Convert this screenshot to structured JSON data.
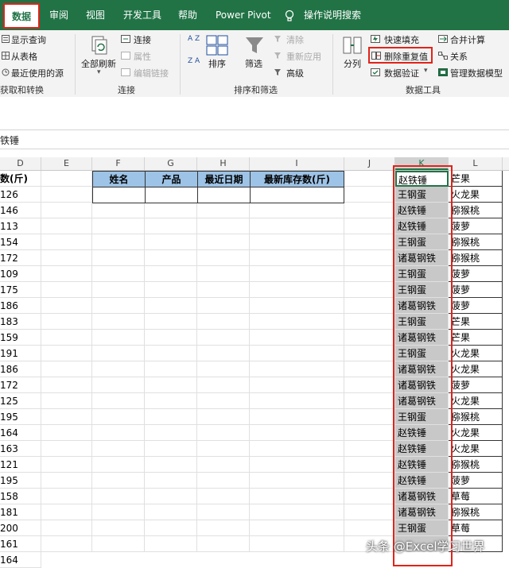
{
  "tabs": [
    "数据",
    "审阅",
    "视图",
    "开发工具",
    "帮助",
    "Power Pivot",
    "操作说明搜索"
  ],
  "ribbon": {
    "get_transform": {
      "items": [
        "显示查询",
        "从表格",
        "最近使用的源"
      ],
      "label": "获取和转换"
    },
    "connections": {
      "refresh_all": "全部刷新",
      "items": [
        "连接",
        "属性",
        "编辑链接"
      ],
      "label": "连接"
    },
    "sort_filter": {
      "sort": "排序",
      "filter": "筛选",
      "items": [
        "清除",
        "重新应用",
        "高级"
      ],
      "label": "排序和筛选"
    },
    "data_tools": {
      "split": "分列",
      "items": [
        "快速填充",
        "删除重复值",
        "数据验证",
        "合并计算",
        "关系",
        "管理数据模型"
      ],
      "label": "数据工具"
    },
    "sort_az": "A Z",
    "sort_za": "Z A"
  },
  "formula_bar": {
    "value": "铁锤"
  },
  "columns": [
    "D",
    "E",
    "F",
    "G",
    "H",
    "I",
    "J",
    "K",
    "L"
  ],
  "headers": {
    "d": "数(斤)",
    "f": "姓名",
    "g": "产品",
    "h": "最近日期",
    "i": "最新库存数(斤)"
  },
  "d_values": [
    "126",
    "146",
    "113",
    "154",
    "172",
    "109",
    "175",
    "186",
    "183",
    "159",
    "191",
    "186",
    "172",
    "125",
    "195",
    "164",
    "163",
    "121",
    "195",
    "158",
    "181",
    "200",
    "161",
    "164"
  ],
  "k_values": [
    "赵铁锤",
    "王钢蛋",
    "赵铁锤",
    "赵铁锤",
    "王钢蛋",
    "诸葛钢铁",
    "王钢蛋",
    "王钢蛋",
    "诸葛钢铁",
    "王钢蛋",
    "诸葛钢铁",
    "王钢蛋",
    "诸葛钢铁",
    "诸葛钢铁",
    "诸葛钢铁",
    "王钢蛋",
    "赵铁锤",
    "赵铁锤",
    "赵铁锤",
    "赵铁锤",
    "诸葛钢铁",
    "诸葛钢铁",
    "王钢蛋",
    ""
  ],
  "l_values": [
    "芒果",
    "火龙果",
    "猕猴桃",
    "菠萝",
    "猕猴桃",
    "猕猴桃",
    "菠萝",
    "菠萝",
    "菠萝",
    "芒果",
    "芒果",
    "火龙果",
    "火龙果",
    "菠萝",
    "火龙果",
    "猕猴桃",
    "火龙果",
    "火龙果",
    "猕猴桃",
    "菠萝",
    "草莓",
    "猕猴桃",
    "草莓",
    ""
  ],
  "watermark": "头条 @Excel学习世界",
  "colors": {
    "excel_green": "#217346",
    "highlight_red": "#e2231a",
    "header_blue": "#9dc3e6",
    "selection_gray": "#c8c8c8"
  }
}
